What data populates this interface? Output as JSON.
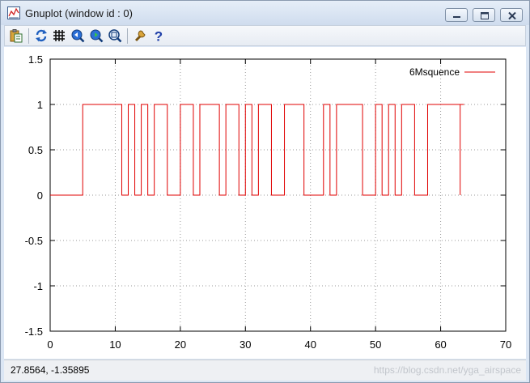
{
  "window": {
    "title": "Gnuplot (window id : 0)",
    "buttons": [
      "minimize",
      "maximize",
      "close"
    ]
  },
  "toolbar": {
    "items": [
      {
        "name": "copy-to-clipboard-icon"
      },
      {
        "name": "replot-icon"
      },
      {
        "name": "grid-icon"
      },
      {
        "name": "zoom-previous-icon"
      },
      {
        "name": "zoom-next-icon"
      },
      {
        "name": "autoscale-icon"
      },
      {
        "name": "options-icon"
      },
      {
        "name": "help-icon"
      }
    ]
  },
  "status": {
    "coordinates": "27.8564, -1.35895",
    "watermark": "https://blog.csdn.net/yga_airspace"
  },
  "colors": {
    "series": "#e00000",
    "grid": "#9a9a9a",
    "axis": "#000000"
  },
  "chart_data": {
    "type": "line",
    "title": "",
    "xlabel": "",
    "ylabel": "",
    "xlim": [
      0,
      70
    ],
    "ylim": [
      -1.5,
      1.5
    ],
    "xticks": [
      0,
      10,
      20,
      30,
      40,
      50,
      60,
      70
    ],
    "xtick_labels": [
      "0",
      "10",
      "20",
      "30",
      "40",
      "50",
      "60",
      "70"
    ],
    "yticks": [
      1.5,
      1,
      0.5,
      0,
      -0.5,
      -1,
      -1.5
    ],
    "ytick_labels": [
      "1.5",
      "1",
      "0.5",
      "0",
      "-0.5",
      "-1",
      "-1.5"
    ],
    "grid": true,
    "legend_position": "top-right",
    "step": "post",
    "series": [
      {
        "name": "6Msquence",
        "x": [
          0,
          5,
          11,
          12,
          13,
          14,
          15,
          16,
          18,
          20,
          22,
          23,
          26,
          27,
          29,
          30,
          31,
          32,
          34,
          36,
          39,
          42,
          43,
          44,
          48,
          50,
          51,
          52,
          53,
          54,
          56,
          58,
          63
        ],
        "y": [
          0,
          1,
          0,
          1,
          0,
          1,
          0,
          1,
          0,
          1,
          0,
          1,
          0,
          1,
          0,
          1,
          0,
          1,
          0,
          1,
          0,
          1,
          0,
          1,
          0,
          1,
          0,
          1,
          0,
          1,
          0,
          1,
          0
        ]
      }
    ],
    "x_end": 63
  }
}
